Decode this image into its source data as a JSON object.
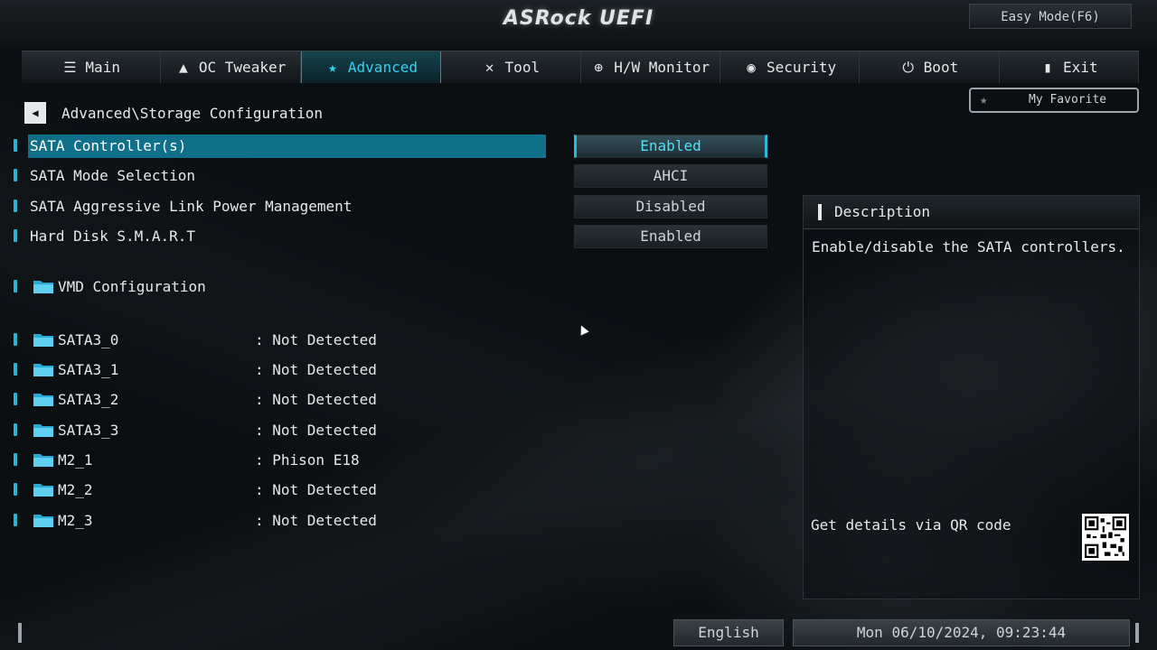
{
  "header": {
    "brand": "ASRock UEFI",
    "easy_mode_label": "Easy Mode(F6)"
  },
  "nav": {
    "tabs": [
      {
        "label": "Main",
        "icon": "list-icon"
      },
      {
        "label": "OC Tweaker",
        "icon": "rocket-icon"
      },
      {
        "label": "Advanced",
        "icon": "star-icon",
        "active": true
      },
      {
        "label": "Tool",
        "icon": "wrench-icon"
      },
      {
        "label": "H/W Monitor",
        "icon": "crosshair-icon"
      },
      {
        "label": "Security",
        "icon": "shield-icon"
      },
      {
        "label": "Boot",
        "icon": "power-icon"
      },
      {
        "label": "Exit",
        "icon": "door-icon"
      }
    ]
  },
  "breadcrumb": "Advanced\\Storage Configuration",
  "favorite_label": "My Favorite",
  "settings": [
    {
      "label": "SATA Controller(s)",
      "value": "Enabled",
      "selected": true
    },
    {
      "label": "SATA Mode Selection",
      "value": "AHCI"
    },
    {
      "label": "SATA Aggressive Link Power Management",
      "value": "Disabled"
    },
    {
      "label": "Hard Disk S.M.A.R.T",
      "value": "Enabled"
    }
  ],
  "submenu": {
    "label": "VMD Configuration"
  },
  "devices": [
    {
      "name": "SATA3_0",
      "status": ": Not Detected"
    },
    {
      "name": "SATA3_1",
      "status": ": Not Detected"
    },
    {
      "name": "SATA3_2",
      "status": ": Not Detected"
    },
    {
      "name": "SATA3_3",
      "status": ": Not Detected"
    },
    {
      "name": "M2_1",
      "status": ": Phison E18"
    },
    {
      "name": "M2_2",
      "status": ": Not Detected"
    },
    {
      "name": "M2_3",
      "status": ": Not Detected"
    }
  ],
  "description": {
    "title": "Description",
    "text": "Enable/disable the SATA controllers.",
    "qr_label": "Get details via QR code"
  },
  "footer": {
    "language": "English",
    "datetime": "Mon 06/10/2024, 09:23:44"
  },
  "colors": {
    "accent": "#2ab3d4",
    "selected_row": "#10708a",
    "active_value_text": "#52e0f5"
  }
}
